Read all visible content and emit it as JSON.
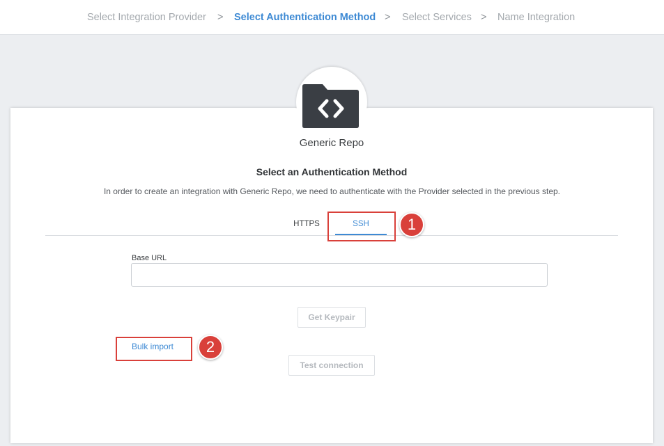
{
  "breadcrumb": {
    "steps": [
      {
        "label": "Select Integration Provider",
        "active": false
      },
      {
        "label": "Select Authentication Method",
        "active": true
      },
      {
        "label": "Select Services",
        "active": false
      },
      {
        "label": "Name Integration",
        "active": false
      }
    ],
    "separator": ">"
  },
  "provider": {
    "name": "Generic Repo",
    "icon": "folder-code-icon"
  },
  "auth": {
    "title": "Select an Authentication Method",
    "description": "In order to create an integration with Generic Repo, we need to authenticate with the Provider selected in the previous step.",
    "tabs": [
      {
        "label": "HTTPS",
        "selected": false
      },
      {
        "label": "SSH",
        "selected": true
      }
    ]
  },
  "form": {
    "base_url_label": "Base URL",
    "base_url_value": "",
    "base_url_placeholder": "",
    "get_keypair_label": "Get Keypair",
    "bulk_import_label": "Bulk import",
    "test_connection_label": "Test connection"
  },
  "annotations": [
    "1",
    "2"
  ],
  "colors": {
    "accent": "#3e8ad4",
    "annotation": "#d9403a",
    "icon_dark": "#3a3e44",
    "background": "#eceef1"
  }
}
